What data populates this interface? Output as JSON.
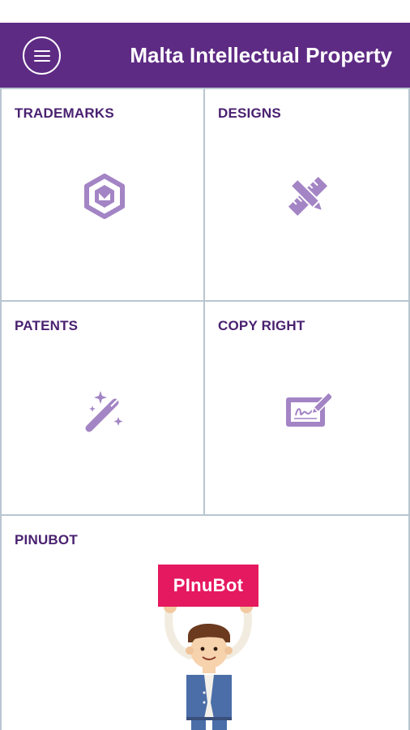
{
  "appbar": {
    "title": "Malta Intellectual Property",
    "menu_icon": "hamburger-menu-icon",
    "color": "#5e2b84"
  },
  "tiles": [
    {
      "label": "TRADEMARKS",
      "icon": "hexagon-badge-icon"
    },
    {
      "label": "DESIGNS",
      "icon": "pencil-ruler-icon"
    },
    {
      "label": "PATENTS",
      "icon": "magic-wand-icon"
    },
    {
      "label": "COPY RIGHT",
      "icon": "signature-tablet-icon"
    },
    {
      "label": "PINUBOT",
      "icon": "pinubot-mascot"
    }
  ],
  "pinubot": {
    "sign_text": "PInuBot",
    "sign_color": "#e5195f"
  },
  "colors": {
    "label": "#4a2170",
    "icon": "#a384c4",
    "grid_line": "#b9c6d0"
  }
}
